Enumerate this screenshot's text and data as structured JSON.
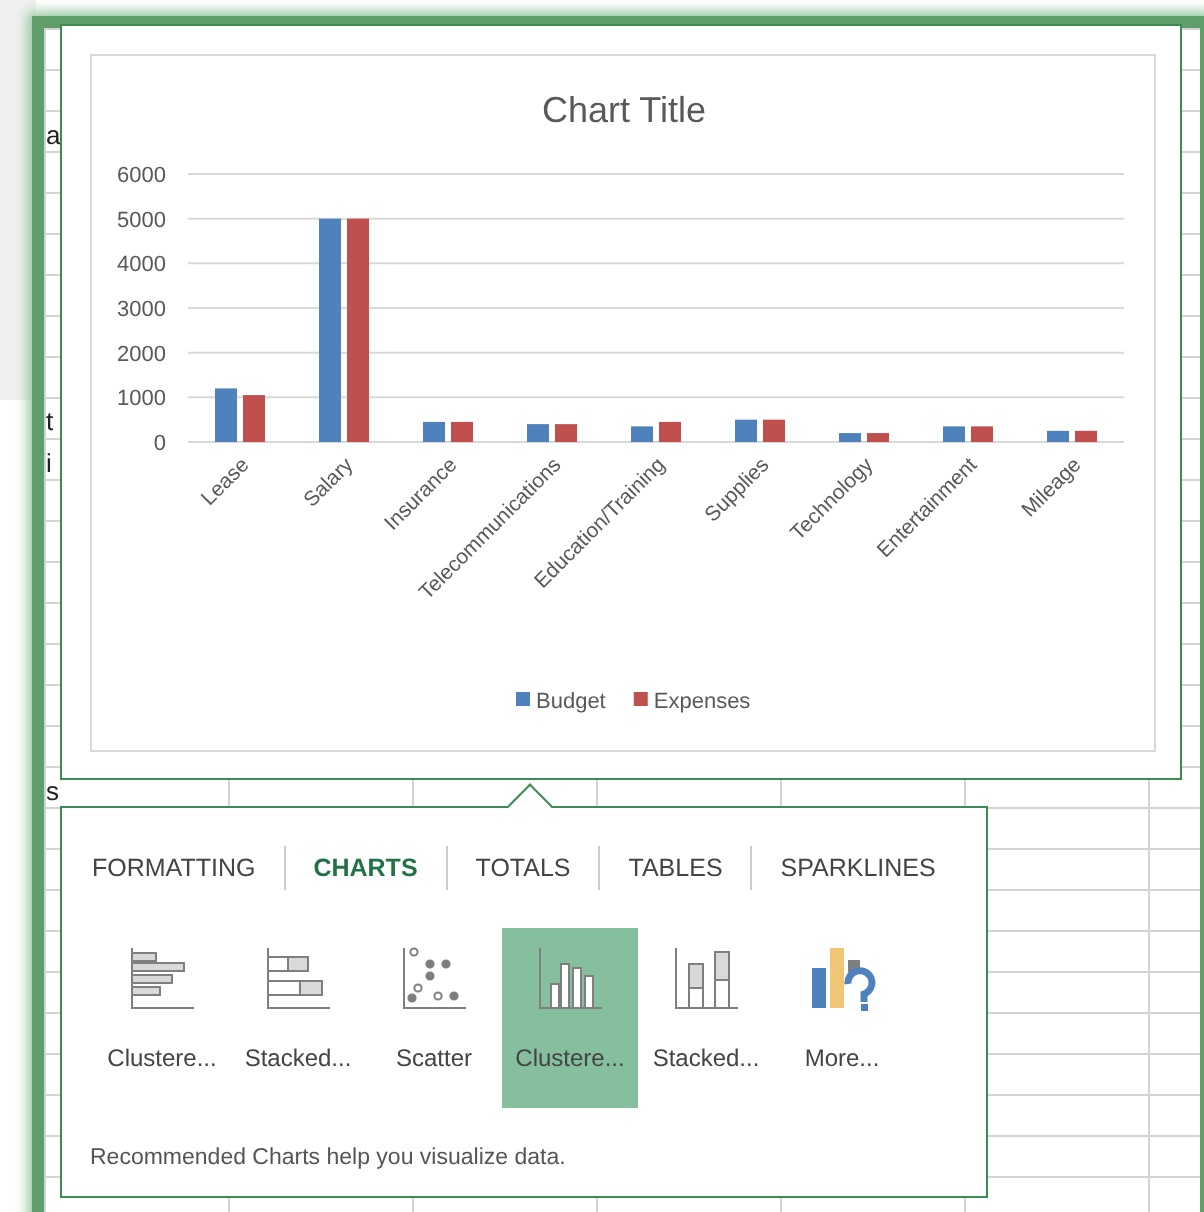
{
  "sheet": {
    "cell_fragments": [
      "a",
      "t",
      "i",
      "s"
    ]
  },
  "chart_preview": {
    "chart_data": {
      "type": "bar",
      "title": "Chart Title",
      "categories": [
        "Lease",
        "Salary",
        "Insurance",
        "Telecommunications",
        "Education/Training",
        "Supplies",
        "Technology",
        "Entertainment",
        "Mileage"
      ],
      "series": [
        {
          "name": "Budget",
          "color": "#4f81bd",
          "values": [
            1200,
            5000,
            450,
            400,
            350,
            500,
            200,
            350,
            250
          ]
        },
        {
          "name": "Expenses",
          "color": "#c0504d",
          "values": [
            1050,
            5000,
            450,
            400,
            450,
            500,
            200,
            350,
            250
          ]
        }
      ],
      "ylim": [
        0,
        6000
      ],
      "yticks": [
        0,
        1000,
        2000,
        3000,
        4000,
        5000,
        6000
      ],
      "grid": true,
      "legend": true
    }
  },
  "quick_analysis": {
    "tabs": [
      {
        "label": "FORMATTING",
        "selected": false
      },
      {
        "label": "CHARTS",
        "selected": true
      },
      {
        "label": "TOTALS",
        "selected": false
      },
      {
        "label": "TABLES",
        "selected": false
      },
      {
        "label": "SPARKLINES",
        "selected": false
      }
    ],
    "options": [
      {
        "kind": "bar-clustered",
        "label": "Clustere...",
        "selected": false
      },
      {
        "kind": "bar-stacked",
        "label": "Stacked...",
        "selected": false
      },
      {
        "kind": "scatter",
        "label": "Scatter",
        "selected": false
      },
      {
        "kind": "column-clustered",
        "label": "Clustere...",
        "selected": true
      },
      {
        "kind": "column-stacked",
        "label": "Stacked...",
        "selected": false
      },
      {
        "kind": "more",
        "label": "More...",
        "selected": false
      }
    ],
    "description": "Recommended Charts help you visualize data."
  }
}
